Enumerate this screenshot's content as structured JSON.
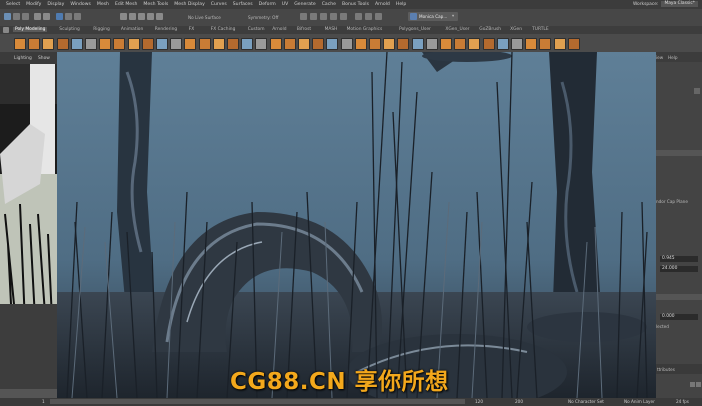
{
  "menu": [
    "Select",
    "Modify",
    "Display",
    "Windows",
    "Mesh",
    "Edit Mesh",
    "Mesh Tools",
    "Mesh Display",
    "Curves",
    "Surfaces",
    "Deform",
    "UV",
    "Generate",
    "Cache",
    "Bonus Tools",
    "Arnold",
    "Help"
  ],
  "workspace": {
    "label": "Workspace:",
    "value": "Maya Classic*"
  },
  "status_line": {
    "surface_mode": "No Live Surface",
    "symmetry": "Symmetry: Off",
    "camera": "Monica Cap..."
  },
  "shelf_tabs": [
    "Poly Modeling",
    "Sculpting",
    "Rigging",
    "Animation",
    "Rendering",
    "FX",
    "FX Caching",
    "Custom",
    "Arnold",
    "Bifrost",
    "MASH",
    "Motion Graphics",
    "Polygons_User",
    "XGen_User",
    "GoZBrush",
    "XGen",
    "TURTLE"
  ],
  "left_panel_menu": [
    "Lighting",
    "Show"
  ],
  "right_panel": {
    "menu": [
      "iew",
      "Help"
    ],
    "cap_label": "ndor Cap Plane",
    "field1": "0.945",
    "field2": "24.000",
    "field3": "0.000",
    "label_bottom": "lected",
    "attributes": "ttributes"
  },
  "bottom_bar": {
    "frame_start": "1",
    "frame_field": "120",
    "frame_end": "200",
    "character_set": "No Character Set",
    "anim_layer": "No Anim Layer",
    "fps": "24 fps"
  },
  "watermark": "CG88.CN 享你所想",
  "colors": {
    "viewport_sky": "#5a7a93",
    "watermark": "#f3a81c",
    "active_tab": "#5a5a5a"
  }
}
